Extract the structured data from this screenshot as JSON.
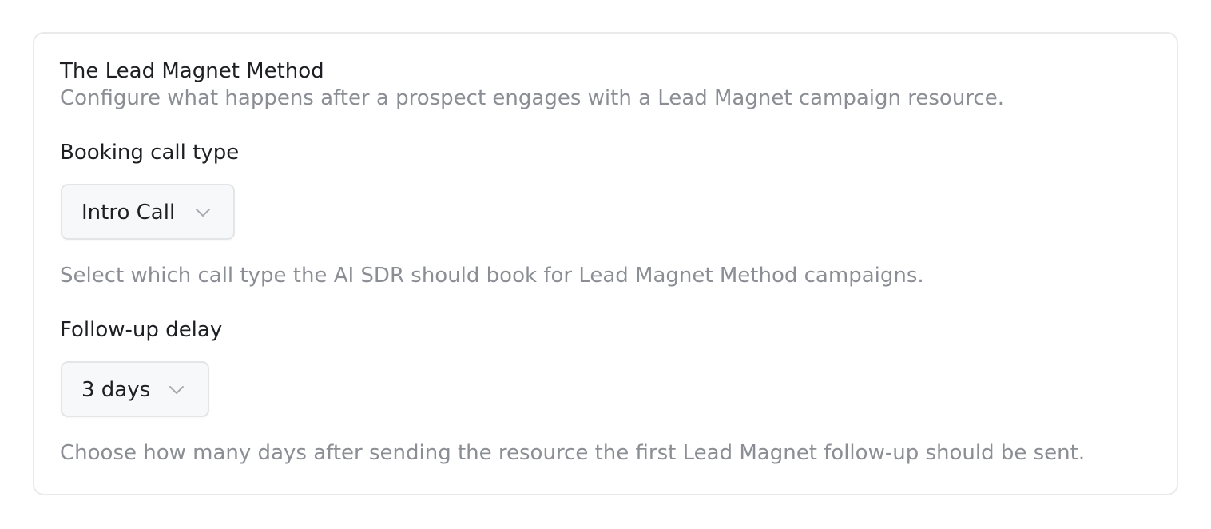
{
  "section": {
    "title": "The Lead Magnet Method",
    "description": "Configure what happens after a prospect engages with a Lead Magnet campaign resource."
  },
  "booking_call_type": {
    "label": "Booking call type",
    "selected": "Intro Call",
    "icon": "chevron-down-icon",
    "helper": "Select which call type the AI SDR should book for Lead Magnet Method campaigns."
  },
  "follow_up_delay": {
    "label": "Follow-up delay",
    "selected": "3 days",
    "icon": "chevron-down-icon",
    "helper": "Choose how many days after sending the resource the first Lead Magnet follow-up should be sent."
  }
}
